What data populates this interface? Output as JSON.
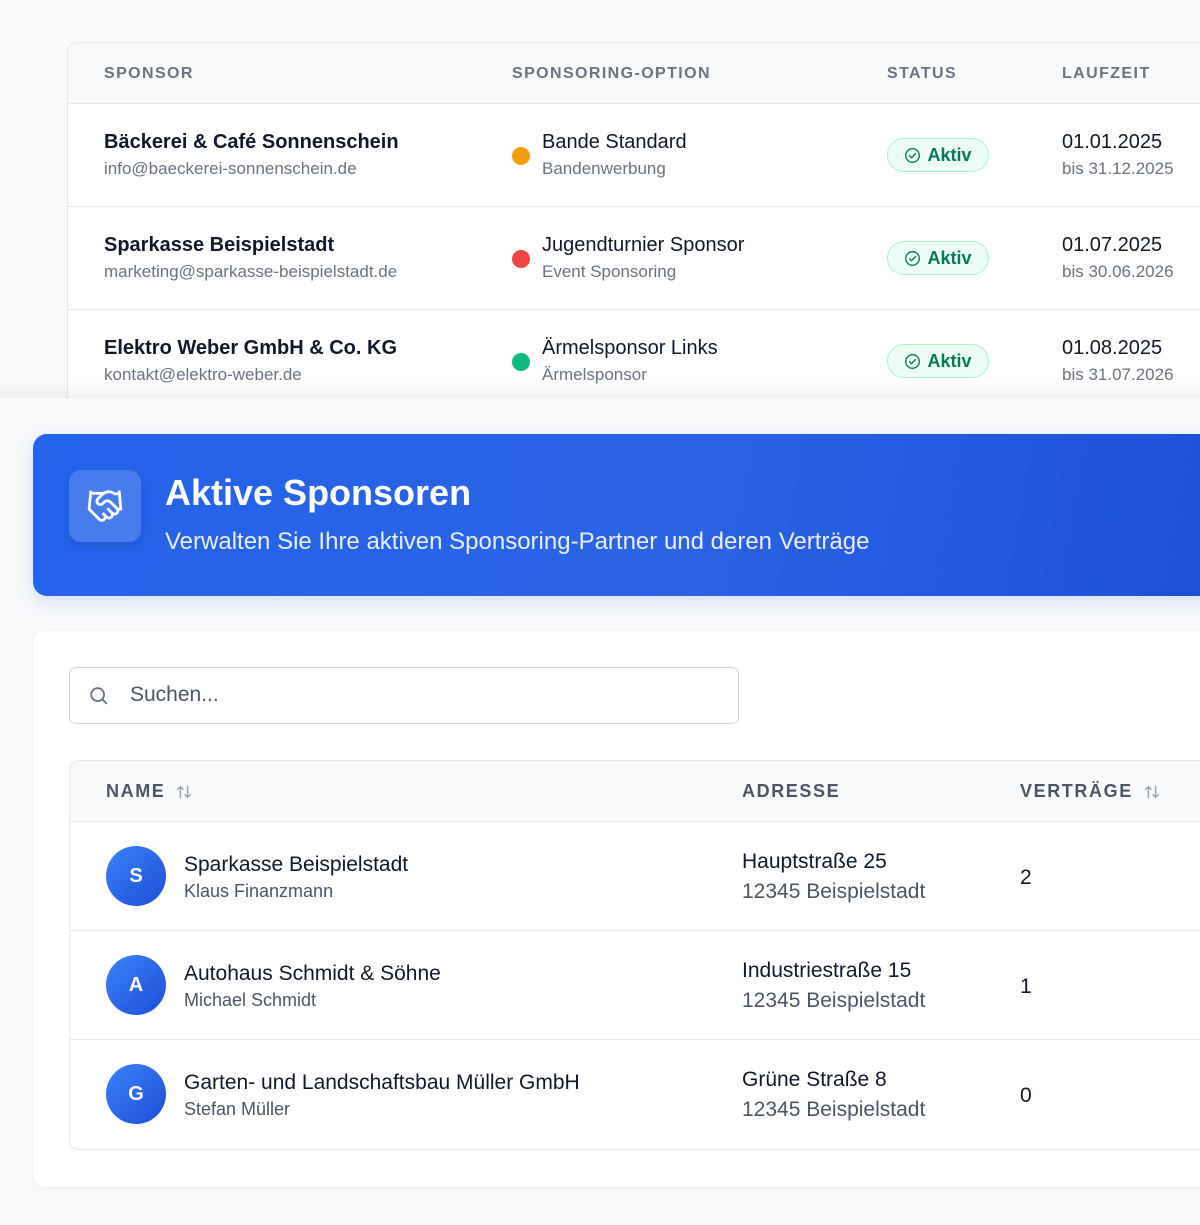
{
  "contracts": {
    "headers": {
      "sponsor": "SPONSOR",
      "option": "SPONSORING-OPTION",
      "status": "STATUS",
      "term": "LAUFZEIT"
    },
    "rows": [
      {
        "sponsor": "Bäckerei & Café Sonnenschein",
        "email": "info@baeckerei-sonnenschein.de",
        "option": "Bande Standard",
        "category": "Bandenwerbung",
        "category_color": "#f59e0b",
        "status": "Aktiv",
        "start": "01.01.2025",
        "end": "bis 31.12.2025"
      },
      {
        "sponsor": "Sparkasse Beispielstadt",
        "email": "marketing@sparkasse-beispielstadt.de",
        "option": "Jugendturnier Sponsor",
        "category": "Event Sponsoring",
        "category_color": "#ef4444",
        "status": "Aktiv",
        "start": "01.07.2025",
        "end": "bis 30.06.2026"
      },
      {
        "sponsor": "Elektro Weber GmbH & Co. KG",
        "email": "kontakt@elektro-weber.de",
        "option": "Ärmelsponsor Links",
        "category": "Ärmelsponsor",
        "category_color": "#10b981",
        "status": "Aktiv",
        "start": "01.08.2025",
        "end": "bis 31.07.2026"
      }
    ]
  },
  "header": {
    "icon": "handshake-icon",
    "title": "Aktive Sponsoren",
    "subtitle": "Verwalten Sie Ihre aktiven Sponsoring-Partner und deren Verträge"
  },
  "search": {
    "placeholder": "Suchen...",
    "value": ""
  },
  "sponsors": {
    "headers": {
      "name": "NAME",
      "address": "ADRESSE",
      "contracts": "VERTRÄGE"
    },
    "rows": [
      {
        "initial": "S",
        "name": "Sparkasse Beispielstadt",
        "contact": "Klaus Finanzmann",
        "street": "Hauptstraße 25",
        "city": "12345 Beispielstadt",
        "contracts": "2"
      },
      {
        "initial": "A",
        "name": "Autohaus Schmidt & Söhne",
        "contact": "Michael Schmidt",
        "street": "Industriestraße 15",
        "city": "12345 Beispielstadt",
        "contracts": "1"
      },
      {
        "initial": "G",
        "name": "Garten- und Landschaftsbau Müller GmbH",
        "contact": "Stefan Müller",
        "street": "Grüne Straße 8",
        "city": "12345 Beispielstadt",
        "contracts": "0"
      }
    ]
  },
  "colors": {
    "accent": "#2563eb",
    "status_active_text": "#047857",
    "status_active_bg": "#ecfdf5"
  }
}
